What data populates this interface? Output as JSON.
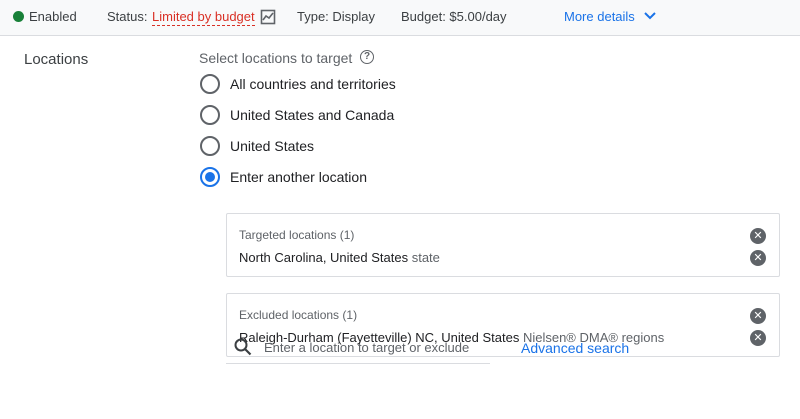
{
  "topbar": {
    "enabled_label": "Enabled",
    "status_label": "Status:",
    "status_value": "Limited by budget",
    "type_text": "Type: Display",
    "budget_text": "Budget: $5.00/day",
    "more_details": "More details",
    "icons": [
      "status-dot-icon",
      "trend-chart-icon",
      "chevron-down-icon"
    ],
    "colors": {
      "enabled": "#188038",
      "limited": "#d93025",
      "link": "#1a73e8"
    }
  },
  "locations": {
    "title": "Locations",
    "select_label": "Select locations to target",
    "help_icon": "?",
    "options": [
      {
        "label": "All countries and territories",
        "checked": false
      },
      {
        "label": "United States and Canada",
        "checked": false
      },
      {
        "label": "United States",
        "checked": false
      },
      {
        "label": "Enter another location",
        "checked": true
      }
    ],
    "targeted": {
      "title": "Targeted locations (1)",
      "value": "North Carolina, United States",
      "sub": "state"
    },
    "excluded": {
      "title": "Excluded locations (1)",
      "value": "Raleigh-Durham (Fayetteville) NC, United States",
      "sub": "Nielsen® DMA® regions"
    },
    "search": {
      "placeholder": "Enter a location to target or exclude",
      "value": ""
    },
    "advanced_search": "Advanced search"
  }
}
